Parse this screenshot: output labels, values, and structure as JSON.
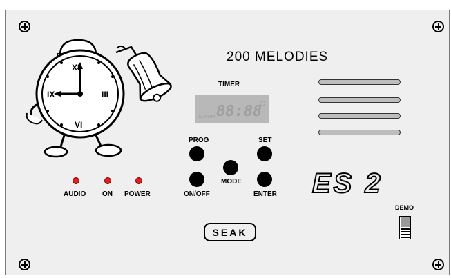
{
  "panel": {
    "title": "200 MELODIES",
    "timer_label": "TIMER",
    "lcd": {
      "digits": "88:88",
      "indicator_text": "ALARM"
    },
    "buttons": {
      "prog": "PROG",
      "set": "SET",
      "onoff": "ON/OFF",
      "mode": "MODE",
      "enter": "ENTER"
    },
    "indicators": [
      "AUDIO",
      "ON",
      "POWER"
    ],
    "brand": "SEAK",
    "model": "ES 2",
    "demo_label": "DEMO",
    "clock_numerals": {
      "twelve": "XII",
      "three": "III",
      "six": "VI",
      "nine": "IX"
    }
  },
  "colors": {
    "panel_bg": "#efefef",
    "led": "#e02020",
    "lcd_bg": "#b8b8b8"
  }
}
